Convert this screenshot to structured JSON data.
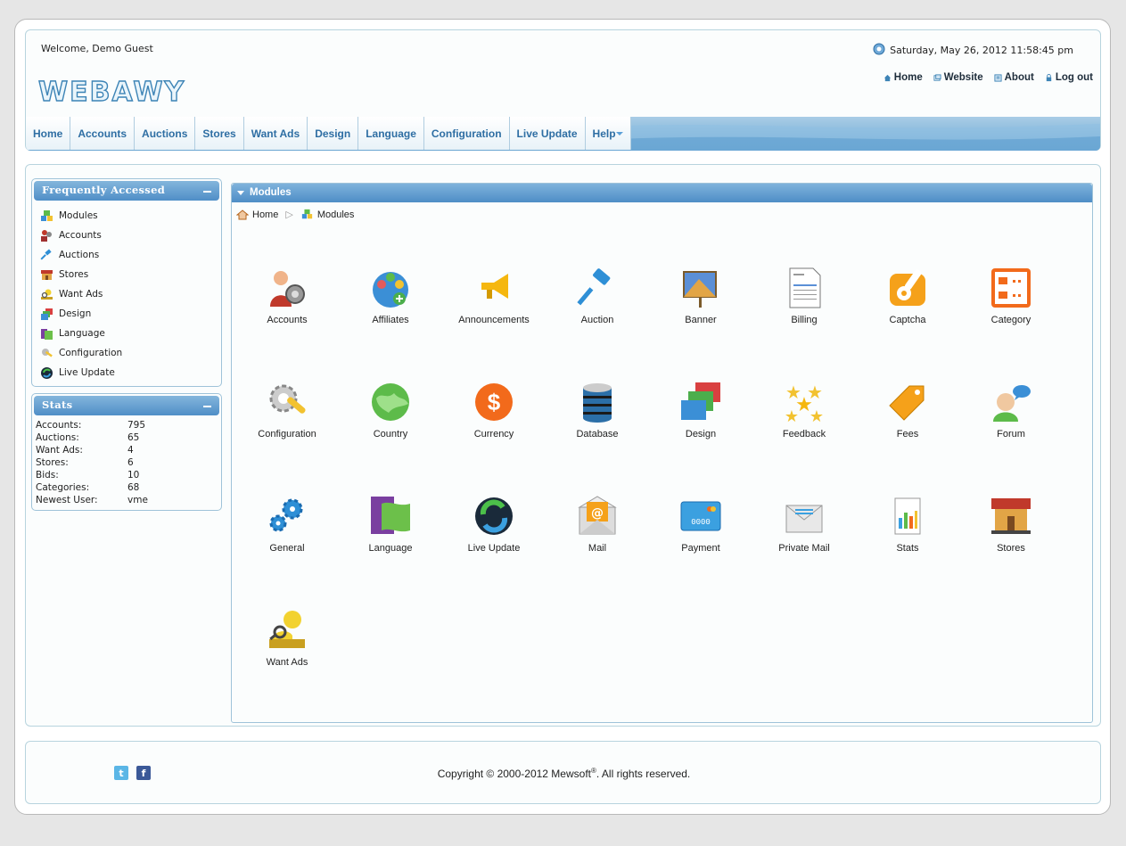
{
  "header": {
    "welcome": "Welcome, Demo Guest",
    "datetime": "Saturday, May 26, 2012 11:58:45 pm",
    "logo": "WEBAWY",
    "links": [
      {
        "label": "Home",
        "icon": "home-icon"
      },
      {
        "label": "Website",
        "icon": "website-icon"
      },
      {
        "label": "About",
        "icon": "about-icon"
      },
      {
        "label": "Log out",
        "icon": "logout-icon"
      }
    ]
  },
  "nav": {
    "items": [
      "Home",
      "Accounts",
      "Auctions",
      "Stores",
      "Want Ads",
      "Design",
      "Language",
      "Configuration",
      "Live Update",
      "Help"
    ],
    "accent": "#2e6ea3"
  },
  "sidebar": {
    "frequent": {
      "title": "Frequently Accessed",
      "items": [
        {
          "label": "Modules",
          "icon": "modules-icon"
        },
        {
          "label": "Accounts",
          "icon": "accounts-icon"
        },
        {
          "label": "Auctions",
          "icon": "auction-icon"
        },
        {
          "label": "Stores",
          "icon": "stores-icon"
        },
        {
          "label": "Want Ads",
          "icon": "want-ads-icon"
        },
        {
          "label": "Design",
          "icon": "design-icon"
        },
        {
          "label": "Language",
          "icon": "language-icon"
        },
        {
          "label": "Configuration",
          "icon": "configuration-icon"
        },
        {
          "label": "Live Update",
          "icon": "live-update-icon"
        }
      ]
    },
    "stats": {
      "title": "Stats",
      "rows": [
        {
          "label": "Accounts:",
          "value": "795"
        },
        {
          "label": "Auctions:",
          "value": "65"
        },
        {
          "label": "Want Ads:",
          "value": "4"
        },
        {
          "label": "Stores:",
          "value": "6"
        },
        {
          "label": "Bids:",
          "value": "10"
        },
        {
          "label": "Categories:",
          "value": "68"
        },
        {
          "label": "Newest User:",
          "value": "vme"
        }
      ]
    }
  },
  "modules": {
    "title": "Modules",
    "breadcrumb": [
      "Home",
      "Modules"
    ],
    "items": [
      {
        "label": "Accounts",
        "icon": "accounts-icon"
      },
      {
        "label": "Affiliates",
        "icon": "affiliates-icon"
      },
      {
        "label": "Announcements",
        "icon": "megaphone-icon"
      },
      {
        "label": "Auction",
        "icon": "gavel-icon"
      },
      {
        "label": "Banner",
        "icon": "banner-icon"
      },
      {
        "label": "Billing",
        "icon": "invoice-icon"
      },
      {
        "label": "Captcha",
        "icon": "captcha-icon"
      },
      {
        "label": "Category",
        "icon": "category-icon"
      },
      {
        "label": "Configuration",
        "icon": "configuration-icon"
      },
      {
        "label": "Country",
        "icon": "globe-icon"
      },
      {
        "label": "Currency",
        "icon": "dollar-icon"
      },
      {
        "label": "Database",
        "icon": "database-icon"
      },
      {
        "label": "Design",
        "icon": "design-icon"
      },
      {
        "label": "Feedback",
        "icon": "stars-icon"
      },
      {
        "label": "Fees",
        "icon": "price-tag-icon"
      },
      {
        "label": "Forum",
        "icon": "forum-icon"
      },
      {
        "label": "General",
        "icon": "gears-icon"
      },
      {
        "label": "Language",
        "icon": "language-flag-icon"
      },
      {
        "label": "Live Update",
        "icon": "live-update-icon"
      },
      {
        "label": "Mail",
        "icon": "mail-icon"
      },
      {
        "label": "Payment",
        "icon": "credit-card-icon"
      },
      {
        "label": "Private Mail",
        "icon": "private-mail-icon"
      },
      {
        "label": "Stats",
        "icon": "stats-icon"
      },
      {
        "label": "Stores",
        "icon": "store-icon"
      },
      {
        "label": "Want Ads",
        "icon": "want-ads-icon"
      }
    ]
  },
  "footer": {
    "copyright": "Copyright © 2000-2012 Mewsoft",
    "reg": "®",
    "rights": ". All rights reserved.",
    "social": [
      {
        "icon": "twitter-icon",
        "glyph": "t"
      },
      {
        "icon": "facebook-icon",
        "glyph": "f"
      }
    ]
  }
}
